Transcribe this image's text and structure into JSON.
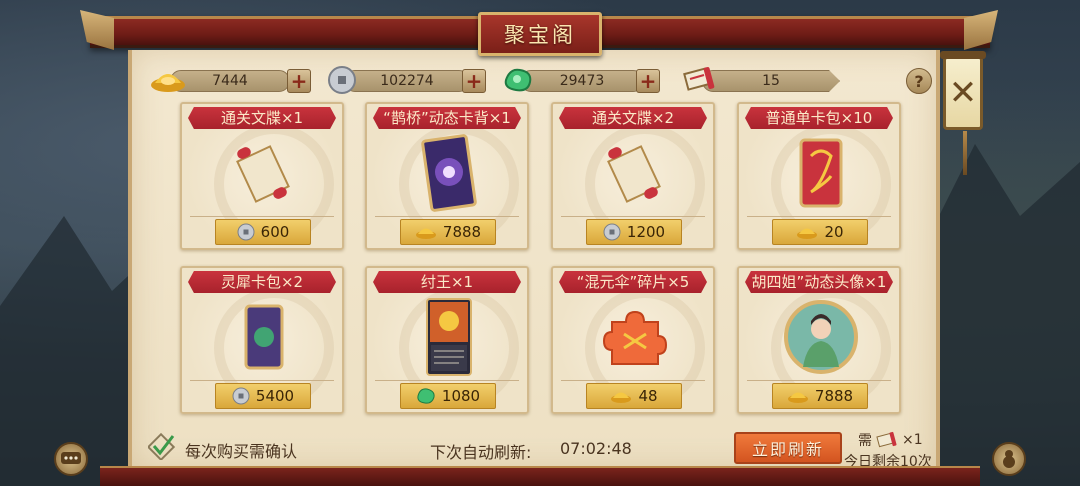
{
  "title": "聚宝阁",
  "currencies": [
    {
      "name": "gold-ingot",
      "value": "7444"
    },
    {
      "name": "silver-coin",
      "value": "102274"
    },
    {
      "name": "jade",
      "value": "29473"
    },
    {
      "name": "refresh-token",
      "value": "15"
    }
  ],
  "items": [
    {
      "title": "通关文牒×1",
      "currency": "silver-coin",
      "price": "600"
    },
    {
      "title": "“鹊桥”动态卡背×1",
      "currency": "gold-ingot",
      "price": "7888"
    },
    {
      "title": "通关文牒×2",
      "currency": "silver-coin",
      "price": "1200"
    },
    {
      "title": "普通单卡包×10",
      "currency": "gold-ingot",
      "price": "20"
    },
    {
      "title": "灵犀卡包×2",
      "currency": "silver-coin",
      "price": "5400"
    },
    {
      "title": "纣王×1",
      "currency": "jade",
      "price": "1080"
    },
    {
      "title": "“混元伞”碎片×5",
      "currency": "gold-ingot",
      "price": "48"
    },
    {
      "title": "胡四姐”动态头像×1",
      "currency": "gold-ingot",
      "price": "7888"
    }
  ],
  "footer": {
    "confirm_label": "每次购买需确认",
    "next_refresh_label": "下次自动刷新:",
    "next_refresh_time": "07:02:48",
    "refresh_button": "立即刷新",
    "need_prefix": "需",
    "need_suffix": "×1",
    "remaining": "今日剩余10次"
  },
  "colors": {
    "card_title": "#c9333d",
    "price_tag": "#e6b94a",
    "refresh_button": "#e2652c",
    "beam": "#7a1f18"
  }
}
